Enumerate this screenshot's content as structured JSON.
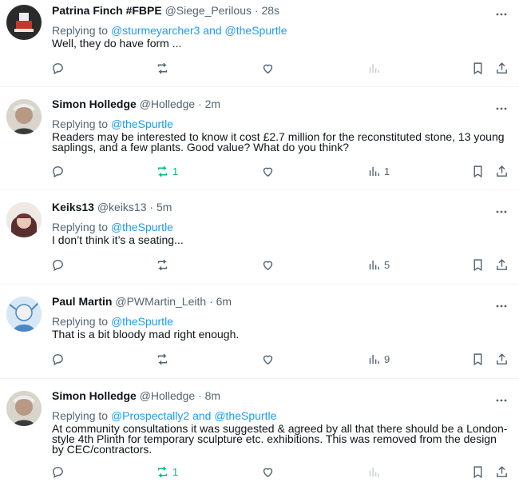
{
  "tweets": [
    {
      "name": "Patrina Finch #FBPE",
      "handle": "@Siege_Perilous",
      "separator": "·",
      "time": "28s",
      "replying_prefix": "Replying to",
      "replying_to": "@sturmeyarcher3 and @theSpurtle",
      "text": "Well, they do have form ...",
      "retweet_count": "",
      "views_count": ""
    },
    {
      "name": "Simon Holledge",
      "handle": "@Holledge",
      "separator": "·",
      "time": "2m",
      "replying_prefix": "Replying to",
      "replying_to": "@theSpurtle",
      "text": "Readers may be interested to know it cost £2.7 million for the reconstituted stone, 13 young saplings, and a few plants. Good value? What do you think?",
      "retweet_count": "1",
      "views_count": "1"
    },
    {
      "name": "Keiks13",
      "handle": "@keiks13",
      "separator": "·",
      "time": "5m",
      "replying_prefix": "Replying to",
      "replying_to": "@theSpurtle",
      "text": "I don’t think it’s a seating...",
      "retweet_count": "",
      "views_count": "5"
    },
    {
      "name": "Paul Martin",
      "handle": "@PWMartin_Leith",
      "separator": "·",
      "time": "6m",
      "replying_prefix": "Replying to",
      "replying_to": "@theSpurtle",
      "text": "That is a bit bloody mad right enough.",
      "retweet_count": "",
      "views_count": "9"
    },
    {
      "name": "Simon Holledge",
      "handle": "@Holledge",
      "separator": "·",
      "time": "8m",
      "replying_prefix": "Replying to",
      "replying_to": "@Prospectally2 and @theSpurtle",
      "text": "At community consultations it was suggested & agreed by all that there should be a London-style 4th Plinth for temporary sculpture etc. exhibitions. This was removed from the design by CEC/contractors.",
      "retweet_count": "1",
      "views_count": ""
    }
  ],
  "icons": {
    "more": "more-icon",
    "reply": "reply-icon",
    "retweet": "retweet-icon",
    "like": "like-icon",
    "views": "views-icon",
    "bookmark": "bookmark-icon",
    "share": "share-icon"
  },
  "colors": {
    "link": "#1d9bf0",
    "muted": "#536471",
    "retweeted": "#00ba7c",
    "divider": "#eff3f4"
  }
}
